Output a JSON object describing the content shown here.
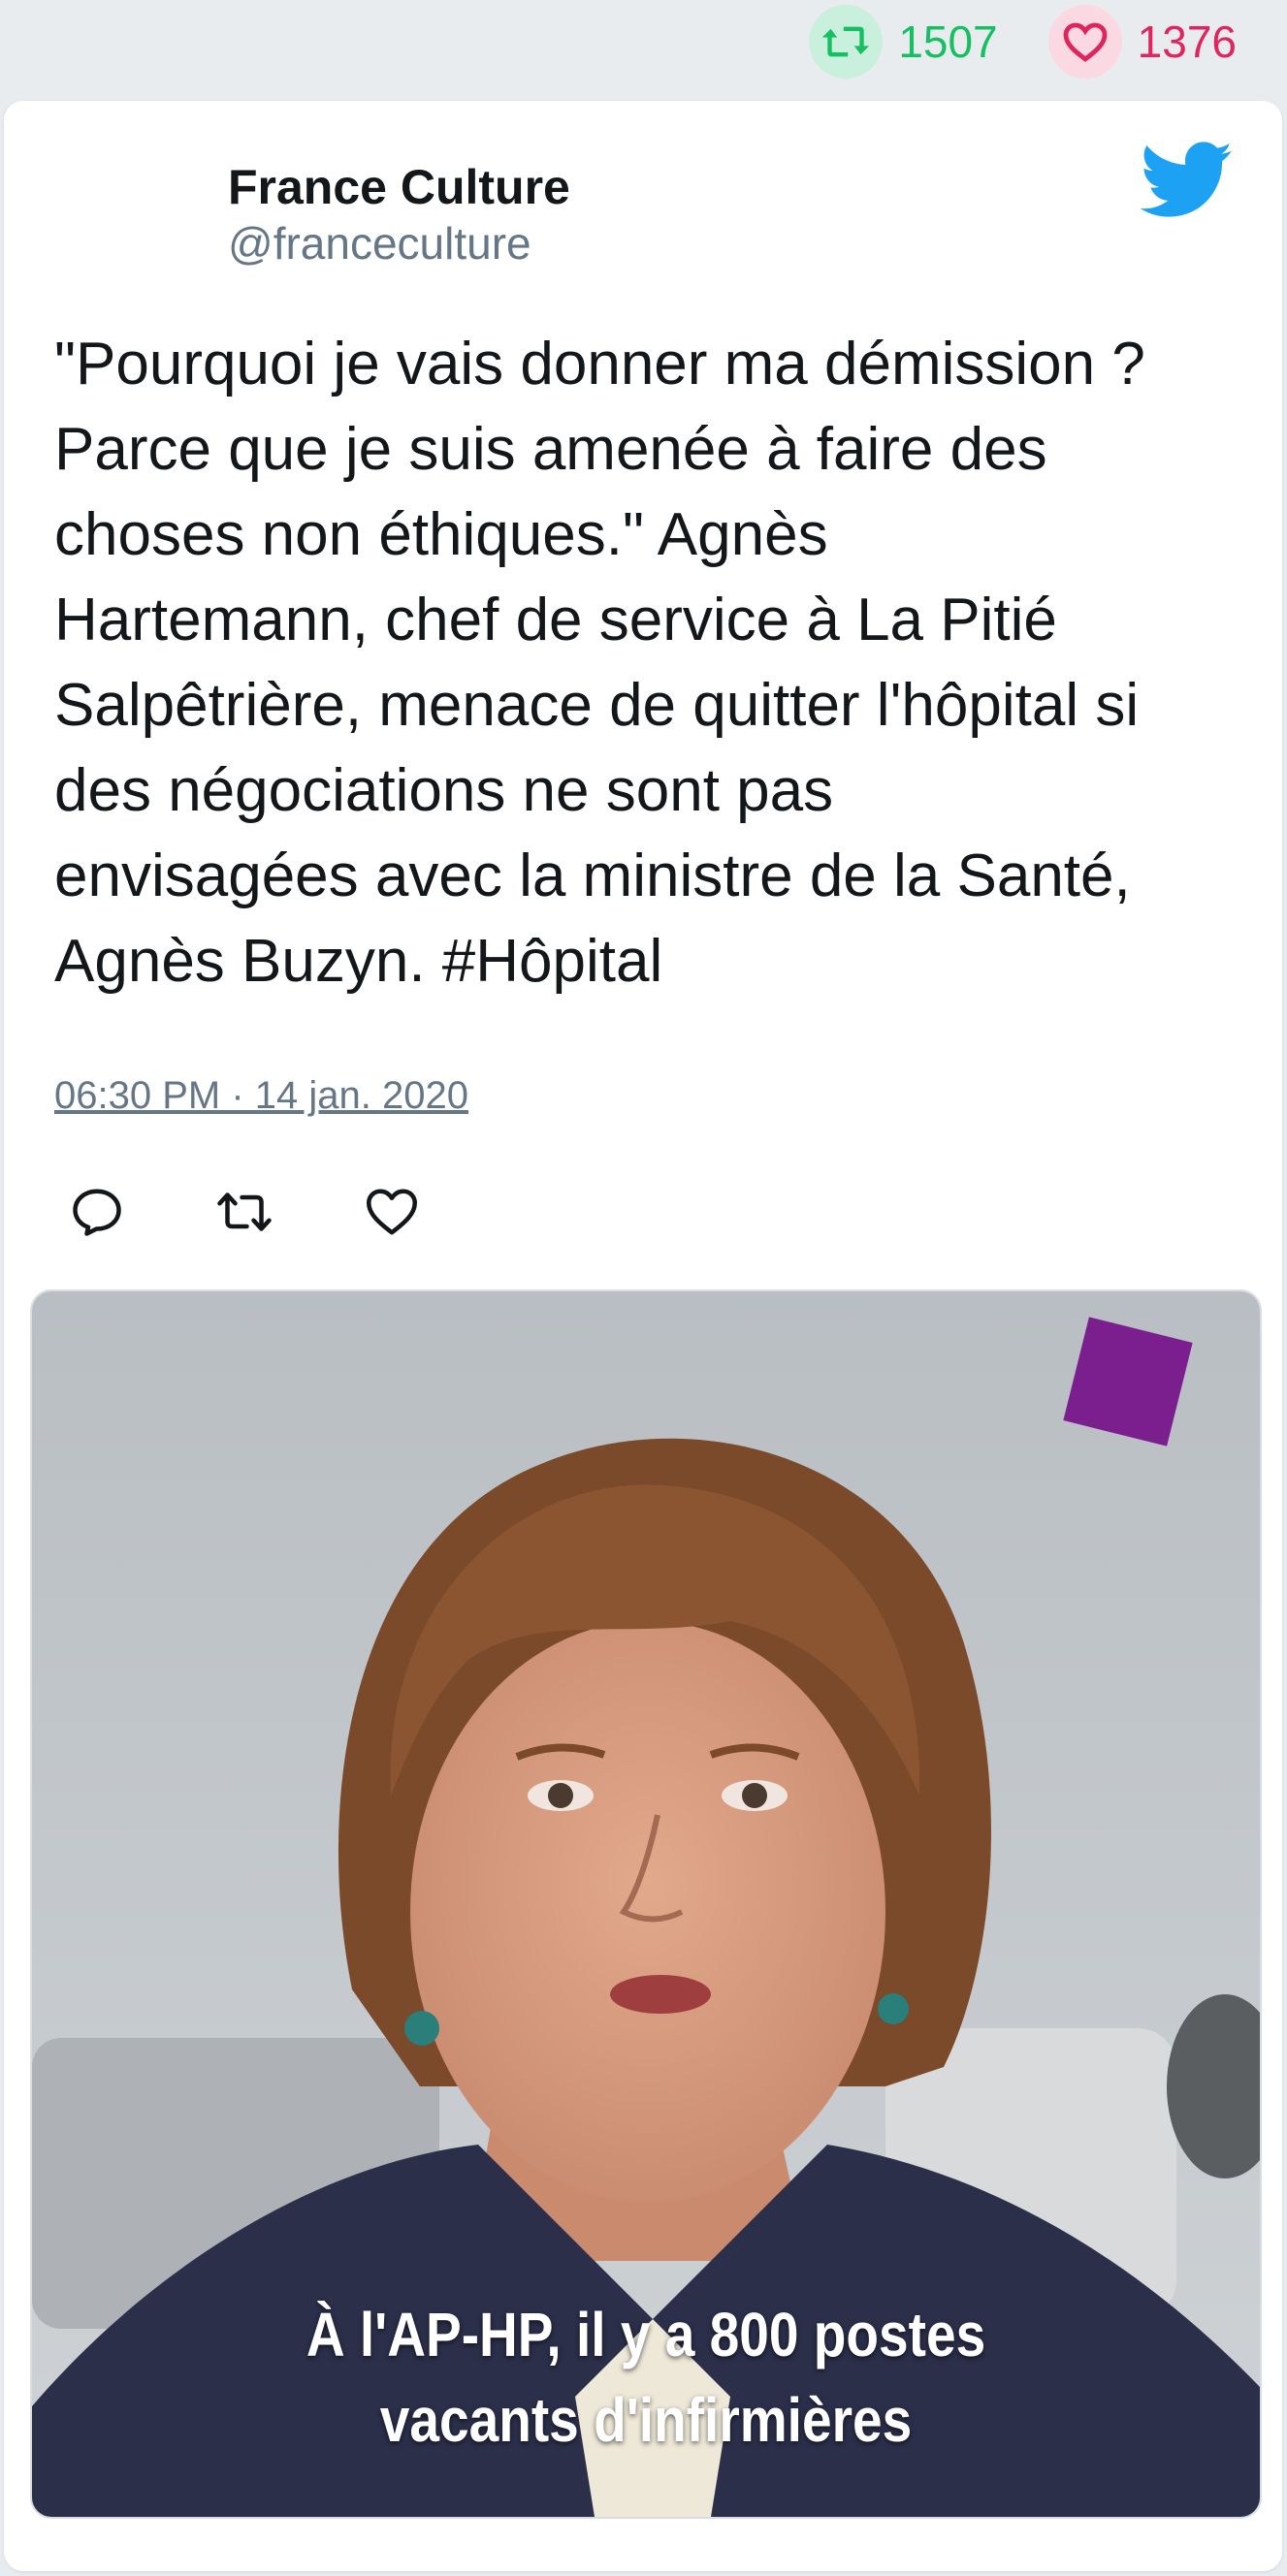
{
  "stats": {
    "retweets": "1507",
    "likes": "1376",
    "retweet_color": "#17bf63",
    "like_color": "#e0245e"
  },
  "tweet": {
    "author_name": "France Culture",
    "author_handle": "@franceculture",
    "text_lines": [
      "\"Pourquoi je vais donner ma démission ?",
      "Parce que je suis amenée à faire des",
      "choses non éthiques.\" Agnès",
      "Hartemann, chef de service à La Pitié",
      "Salpêtrière, menace de quitter l'hôpital si",
      "des négociations ne sont pas",
      "envisagées avec la ministre de la Santé,",
      "Agnès Buzyn. #Hôpital"
    ],
    "timestamp": "06:30 PM · 14 jan. 2020",
    "platform_icon": "twitter-bird-icon",
    "brand_color": "#1da1f2"
  },
  "media": {
    "caption_lines": [
      "À l'AP-HP, il y a 800 postes",
      "vacants d'infirmières"
    ]
  }
}
